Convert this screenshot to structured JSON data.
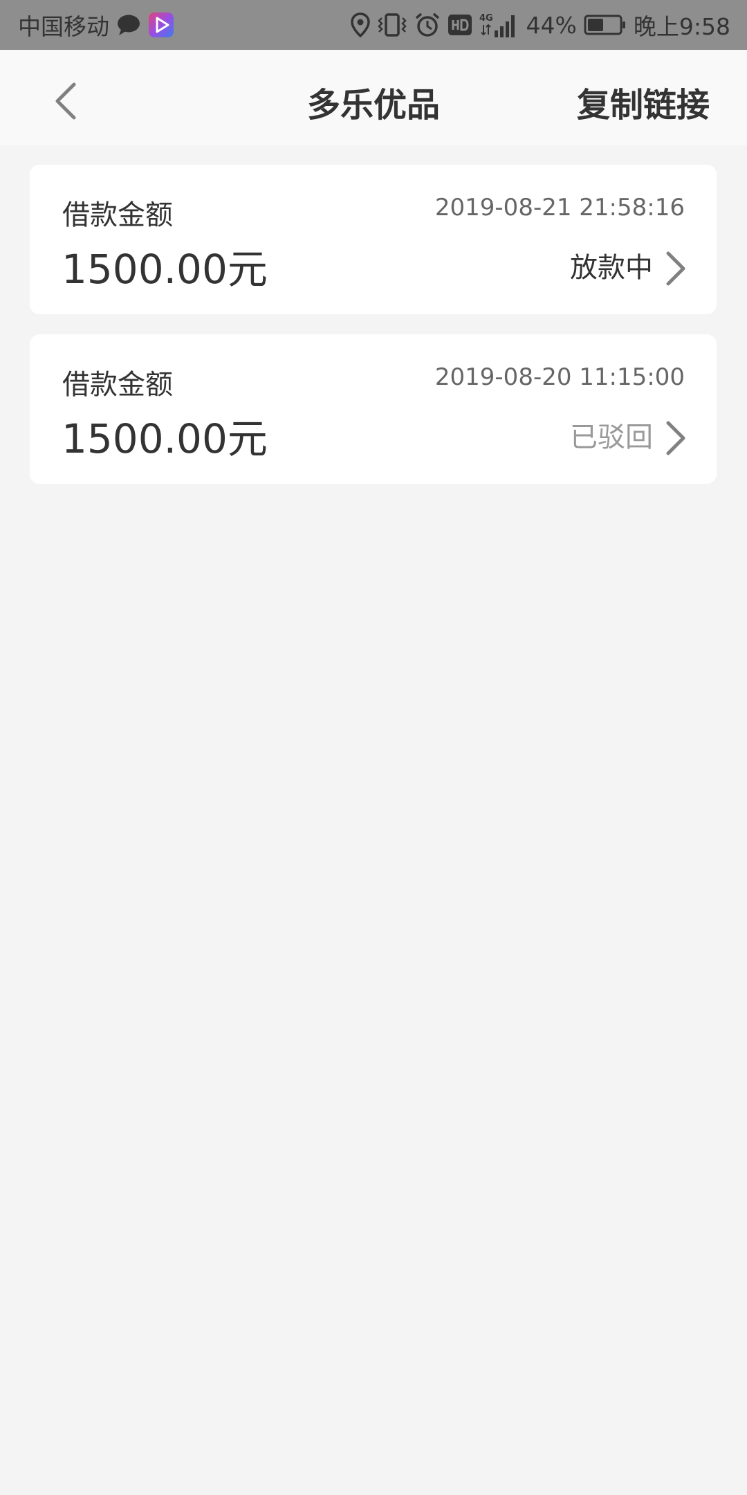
{
  "status_bar": {
    "carrier": "中国移动",
    "network": "4G",
    "battery": "44%",
    "time": "晚上9:58",
    "icons": [
      "chat-bubble-icon",
      "video-app-icon",
      "location-icon",
      "vibrate-icon",
      "alarm-icon",
      "hd-icon",
      "signal-icon",
      "battery-icon"
    ]
  },
  "nav": {
    "title": "多乐优品",
    "action_label": "复制链接",
    "back_icon": "chevron-left-icon"
  },
  "loans": [
    {
      "label": "借款金额",
      "amount": "1500.00元",
      "time": "2019-08-21 21:58:16",
      "status": "放款中",
      "status_color": "#333333"
    },
    {
      "label": "借款金额",
      "amount": "1500.00元",
      "time": "2019-08-20 11:15:00",
      "status": "已驳回",
      "status_color": "#999999"
    }
  ],
  "colors": {
    "status_bar_bg": "#8e8e8e",
    "nav_bg": "#f9f9f9",
    "page_bg": "#f4f4f4",
    "card_bg": "#ffffff",
    "text_primary": "#333333",
    "text_secondary": "#666666",
    "chevron": "#808080"
  }
}
